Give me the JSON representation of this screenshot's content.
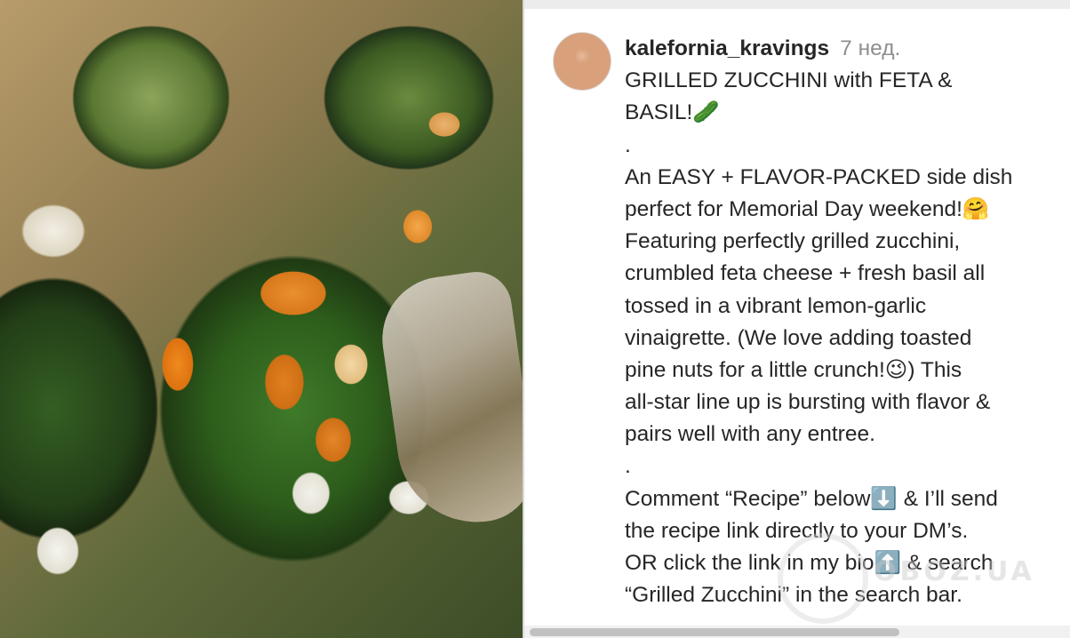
{
  "post": {
    "username": "kalefornia_kravings",
    "time": "7 нед.",
    "lines": [
      "GRILLED ZUCCHINI with FETA &",
      "BASIL!🥒",
      ".",
      "An EASY + FLAVOR-PACKED side dish",
      "perfect for Memorial Day weekend!🤗",
      "Featuring perfectly grilled zucchini,",
      "crumbled feta cheese + fresh basil all",
      "tossed in a vibrant lemon-garlic",
      "vinaigrette. (We love adding toasted",
      "pine nuts for a little crunch!😉) This",
      "all-star line up is bursting with flavor &",
      "pairs well with any entree.",
      ".",
      "Comment “Recipe” below⬇️ & I’ll send",
      "the recipe link directly to your DM’s.",
      "OR click the link in my bio⬆️ & search",
      "“Grilled Zucchini” in the search bar."
    ]
  },
  "photo": {
    "description_icon": "food-photo"
  },
  "watermark": {
    "text": "OBOZ.UA"
  },
  "colors": {
    "text": "#262626",
    "secondary": "#8e8e8e"
  }
}
